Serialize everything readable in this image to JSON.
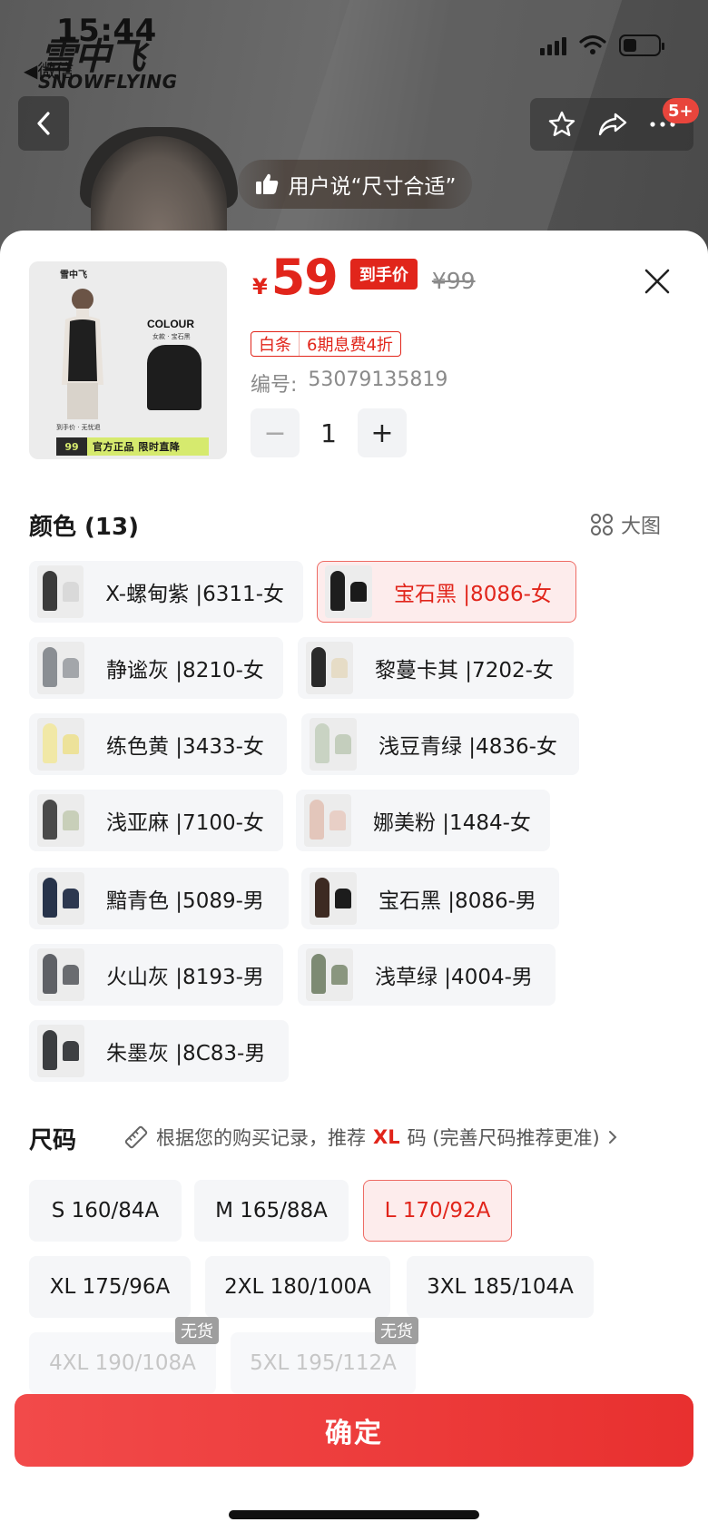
{
  "status_bar": {
    "time": "15:44",
    "back_app": "◀微信"
  },
  "brand": {
    "name_cn": "雪中飞",
    "name_en": "SNOWFLYING"
  },
  "nav": {
    "badge": "5+"
  },
  "review": {
    "text": "用户说“尺寸合适”"
  },
  "product": {
    "thumb": {
      "logo": "雪中飞",
      "colour_title": "COLOUR",
      "colour_sub": "女款 · 宝石黑",
      "promo_top": "到手价 · 无忧退",
      "promo_price": "99",
      "promo_text": "官方正品 限时直降"
    },
    "currency": "¥",
    "price": "59",
    "price_tag": "到手价",
    "original_price": "¥99",
    "credit": {
      "label": "白条",
      "offer": "6期息费4折"
    },
    "sku_label": "编号:",
    "sku": "53079135819",
    "quantity": "1",
    "qty_minus": "−",
    "qty_plus": "+"
  },
  "color_section": {
    "title": "颜色 (13)",
    "bigview": "大图",
    "options": [
      {
        "label": "X-螺甸紫 |6311-女",
        "selected": false,
        "swatch": [
          "#3b3b3b",
          "#d9d9d9"
        ]
      },
      {
        "label": "宝石黑 |8086-女",
        "selected": true,
        "swatch": [
          "#1e1e1e",
          "#1a1a1a"
        ]
      },
      {
        "label": "静谧灰 |8210-女",
        "selected": false,
        "swatch": [
          "#8a8e93",
          "#a3a6aa"
        ]
      },
      {
        "label": "黎蔓卡其 |7202-女",
        "selected": false,
        "swatch": [
          "#2a2a2a",
          "#e6dcc6"
        ]
      },
      {
        "label": "练色黄 |3433-女",
        "selected": false,
        "swatch": [
          "#f1e8a6",
          "#ede29a"
        ]
      },
      {
        "label": "浅豆青绿 |4836-女",
        "selected": false,
        "swatch": [
          "#c9d3c3",
          "#c4cebd"
        ]
      },
      {
        "label": "浅亚麻 |7100-女",
        "selected": false,
        "swatch": [
          "#4a4a4a",
          "#c8cfb9"
        ]
      },
      {
        "label": "娜美粉 |1484-女",
        "selected": false,
        "swatch": [
          "#e3c6bb",
          "#e8cfc6"
        ]
      },
      {
        "label": "黯青色 |5089-男",
        "selected": false,
        "swatch": [
          "#27334a",
          "#2d3850"
        ]
      },
      {
        "label": "宝石黑 |8086-男",
        "selected": false,
        "swatch": [
          "#3d2a22",
          "#1c1c1c"
        ]
      },
      {
        "label": "火山灰 |8193-男",
        "selected": false,
        "swatch": [
          "#5f6166",
          "#6a6c70"
        ]
      },
      {
        "label": "浅草绿 |4004-男",
        "selected": false,
        "swatch": [
          "#7d8a73",
          "#8a967f"
        ]
      },
      {
        "label": "朱墨灰 |8C83-男",
        "selected": false,
        "swatch": [
          "#3b3d40",
          "#3e4043"
        ]
      }
    ]
  },
  "size_section": {
    "title": "尺码",
    "hint_prefix": "根据您的购买记录，推荐",
    "hint_highlight": "XL",
    "hint_suffix": "码 (完善尺码推荐更准)",
    "options": [
      {
        "label": "S 160/84A",
        "state": "normal"
      },
      {
        "label": "M 165/88A",
        "state": "normal"
      },
      {
        "label": "L 170/92A",
        "state": "selected"
      },
      {
        "label": "XL 175/96A",
        "state": "normal"
      },
      {
        "label": "2XL 180/100A",
        "state": "normal"
      },
      {
        "label": "3XL 185/104A",
        "state": "normal"
      },
      {
        "label": "4XL 190/108A",
        "state": "disabled",
        "badge": "无货"
      },
      {
        "label": "5XL 195/112A",
        "state": "disabled",
        "badge": "无货"
      }
    ]
  },
  "confirm": {
    "label": "确定"
  },
  "colors": {
    "accent": "#e1251b",
    "selected_bg": "#fdecec",
    "chip_bg": "#f5f6f8"
  }
}
